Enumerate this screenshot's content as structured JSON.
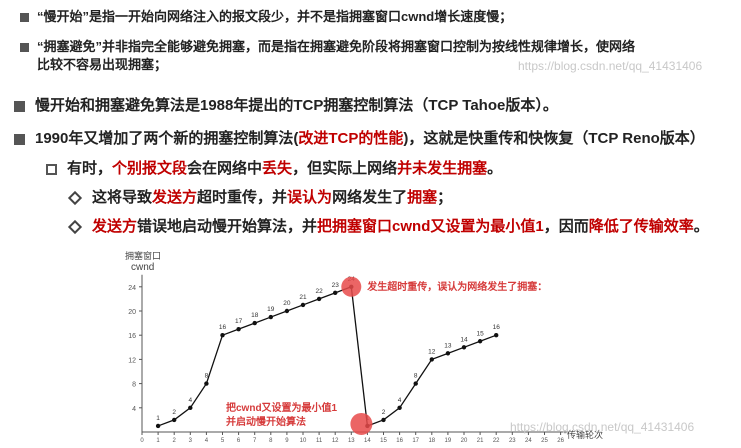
{
  "bullets_top": [
    "“慢开始”是指一开始向网络注入的报文段少，并不是指拥塞窗口cwnd增长速度慢；",
    "“拥塞避免”并非指完全能够避免拥塞，而是指在拥塞避免阶段将拥塞窗口控制为按线性规律增长，使网络",
    "比较不容易出现拥塞；"
  ],
  "watermark": "https://blog.csdn.net/qq_41431406",
  "main": {
    "line1": "慢开始和拥塞避免算法是1988年提出的TCP拥塞控制算法（TCP Tahoe版本）。",
    "line2_a": "1990年又增加了两个新的拥塞控制算法(",
    "line2_red": "改进TCP的性能",
    "line2_b": ")，这就是快重传和快恢复（TCP Reno版本）",
    "line3_a": "有时，",
    "line3_red1": "个别报文段",
    "line3_b": "会在网络中",
    "line3_red2": "丢失",
    "line3_c": "，但实际上网络",
    "line3_red3": "并未发生拥塞",
    "line3_d": "。",
    "line4_a": "这将导致",
    "line4_red1": "发送方",
    "line4_b": "超时重传，并",
    "line4_red2": "误认为",
    "line4_c": "网络发生了",
    "line4_red3": "拥塞",
    "line4_d": "；",
    "line5_red1": "发送方",
    "line5_a": "错误地启动慢开始算法，并",
    "line5_red2": "把拥塞窗口cwnd又设置为最小值1",
    "line5_b": "，因而",
    "line5_red3": "降低了传输效率",
    "line5_c": "。"
  },
  "chart_data": {
    "type": "line",
    "ylabel_top": "拥塞窗口",
    "ylabel": "cwnd",
    "xlabel": "传输轮次",
    "ylim": [
      0,
      26
    ],
    "y_ticks": [
      4,
      8,
      12,
      16,
      20,
      24
    ],
    "x_ticks": [
      0,
      1,
      2,
      3,
      4,
      5,
      6,
      7,
      8,
      9,
      10,
      11,
      12,
      13,
      14,
      15,
      16,
      17,
      18,
      19,
      20,
      21,
      22,
      23,
      24,
      25,
      26
    ],
    "points": [
      {
        "x": 1,
        "y": 1
      },
      {
        "x": 2,
        "y": 2
      },
      {
        "x": 3,
        "y": 4
      },
      {
        "x": 4,
        "y": 8
      },
      {
        "x": 5,
        "y": 16
      },
      {
        "x": 6,
        "y": 17
      },
      {
        "x": 7,
        "y": 18
      },
      {
        "x": 8,
        "y": 19
      },
      {
        "x": 9,
        "y": 20
      },
      {
        "x": 10,
        "y": 21
      },
      {
        "x": 11,
        "y": 22
      },
      {
        "x": 12,
        "y": 23
      },
      {
        "x": 13,
        "y": 24
      },
      {
        "x": 14,
        "y": 1
      },
      {
        "x": 15,
        "y": 2
      },
      {
        "x": 16,
        "y": 4
      },
      {
        "x": 17,
        "y": 8
      },
      {
        "x": 18,
        "y": 12
      },
      {
        "x": 19,
        "y": 13
      },
      {
        "x": 20,
        "y": 14
      },
      {
        "x": 21,
        "y": 15
      },
      {
        "x": 22,
        "y": 16
      }
    ],
    "annotation_top": "发生超时重传，误认为网络发生了拥塞：",
    "annotation_bottom_1": "把cwnd又设置为最小值1",
    "annotation_bottom_2": "并启动慢开始算法",
    "accent": "#e84a4a"
  }
}
